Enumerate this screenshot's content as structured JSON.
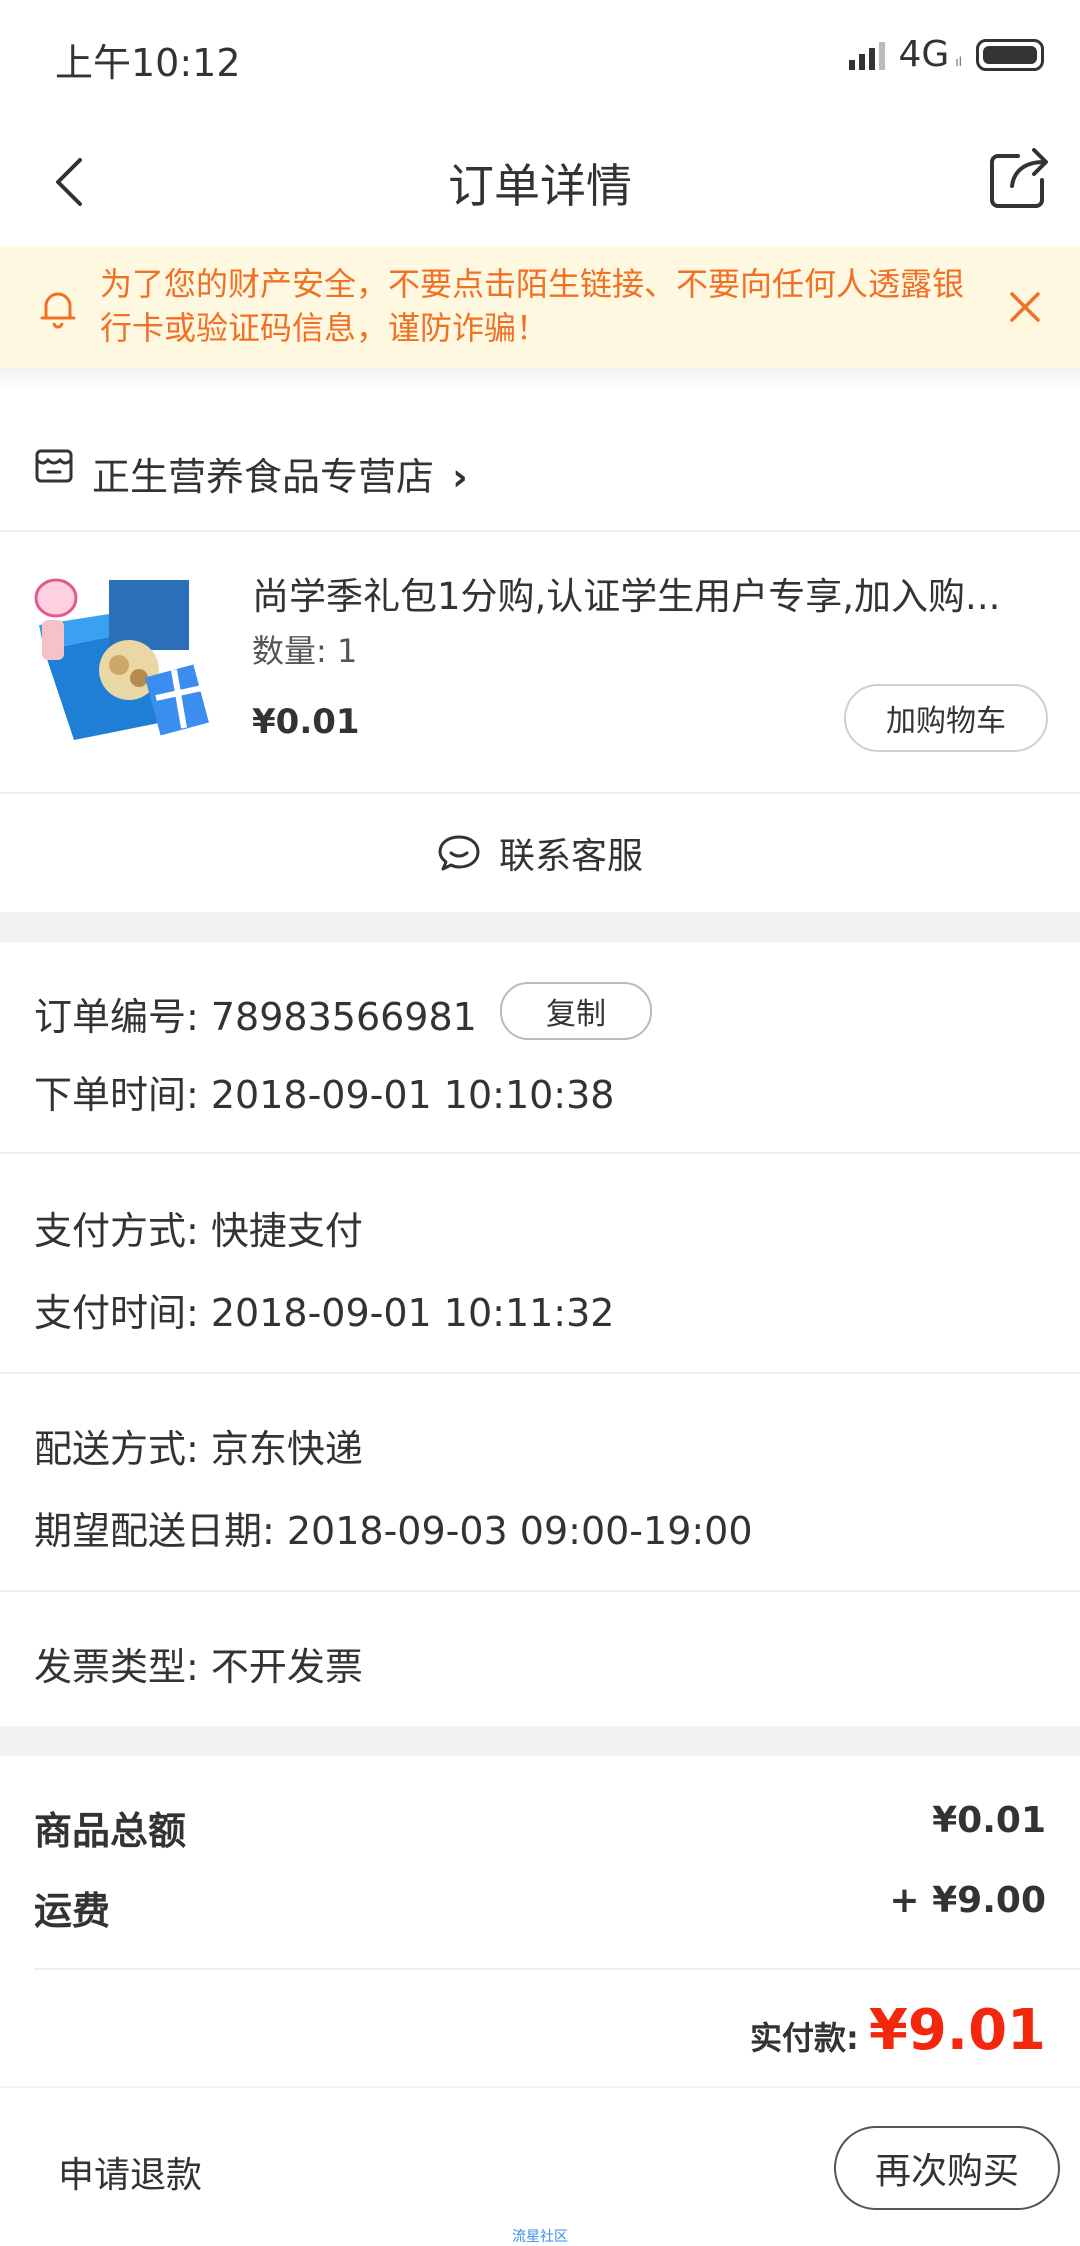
{
  "status_bar": {
    "time": "上午10:12",
    "network": "4G",
    "network_sub": "ıl"
  },
  "header": {
    "title": "订单详情"
  },
  "warning": {
    "text": "为了您的财产安全，不要点击陌生链接、不要向任何人透露银行卡或验证码信息，谨防诈骗！"
  },
  "store": {
    "name": "正生营养食品专营店",
    "chevron": "›"
  },
  "product": {
    "title": "尚学季礼包1分购,认证学生用户专享,加入购...",
    "quantity": "数量: 1",
    "price": "¥0.01",
    "add_cart_label": "加购物车"
  },
  "contact": {
    "label": "联系客服"
  },
  "order_info": {
    "order_no": "订单编号: 78983566981",
    "copy_label": "复制",
    "order_time": "下单时间: 2018-09-01 10:10:38",
    "pay_method": "支付方式: 快捷支付",
    "pay_time": "支付时间: 2018-09-01 10:11:32",
    "delivery_method": "配送方式: 京东快递",
    "delivery_date": "期望配送日期: 2018-09-03 09:00-19:00",
    "invoice": "发票类型: 不开发票"
  },
  "amounts": {
    "goods_label": "商品总额",
    "goods_value": "¥0.01",
    "shipping_label": "运费",
    "shipping_value": "+ ¥9.00",
    "paid_label": "实付款:",
    "paid_value": "¥9.01"
  },
  "bottom": {
    "refund_label": "申请退款",
    "rebuy_label": "再次购买",
    "watermark": "流星社区"
  },
  "colors": {
    "accent_red": "#f2270c",
    "warning_orange": "#f07024",
    "warning_bg": "#fff8e0"
  }
}
